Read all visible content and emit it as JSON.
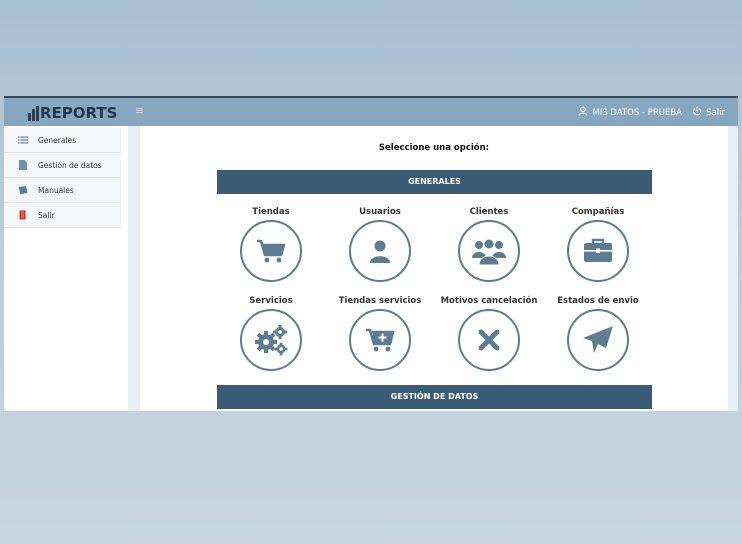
{
  "header": {
    "logo_text": "REPORTS",
    "menu_icon": "hamburger-icon",
    "user_label": "MIS DATOS - PRUEBA",
    "user_icon": "user-icon",
    "logout_label": "Salir",
    "logout_icon": "power-icon"
  },
  "sidebar": {
    "items": [
      {
        "label": "Generales",
        "icon": "list-icon"
      },
      {
        "label": "Gestión de datos",
        "icon": "document-icon"
      },
      {
        "label": "Manuales",
        "icon": "book-icon"
      },
      {
        "label": "Salir",
        "icon": "exit-icon"
      }
    ]
  },
  "main": {
    "title": "Seleccione una opción:",
    "sections": [
      {
        "header": "GENERALES",
        "options": [
          {
            "label": "Tiendas",
            "icon": "cart-icon"
          },
          {
            "label": "Usuarios",
            "icon": "user-icon"
          },
          {
            "label": "Clientes",
            "icon": "users-group-icon"
          },
          {
            "label": "Compañías",
            "icon": "briefcase-icon"
          },
          {
            "label": "Servicios",
            "icon": "gears-icon"
          },
          {
            "label": "Tiendas servicios",
            "icon": "cart-plus-icon"
          },
          {
            "label": "Motivos cancelación",
            "icon": "close-icon"
          },
          {
            "label": "Estados de envio",
            "icon": "paper-plane-icon"
          }
        ]
      },
      {
        "header": "GESTIÓN DE DATOS"
      }
    ]
  },
  "colors": {
    "topbar": "#87a6c0",
    "section_header": "#3a5c76",
    "icon": "#5c7c93"
  }
}
